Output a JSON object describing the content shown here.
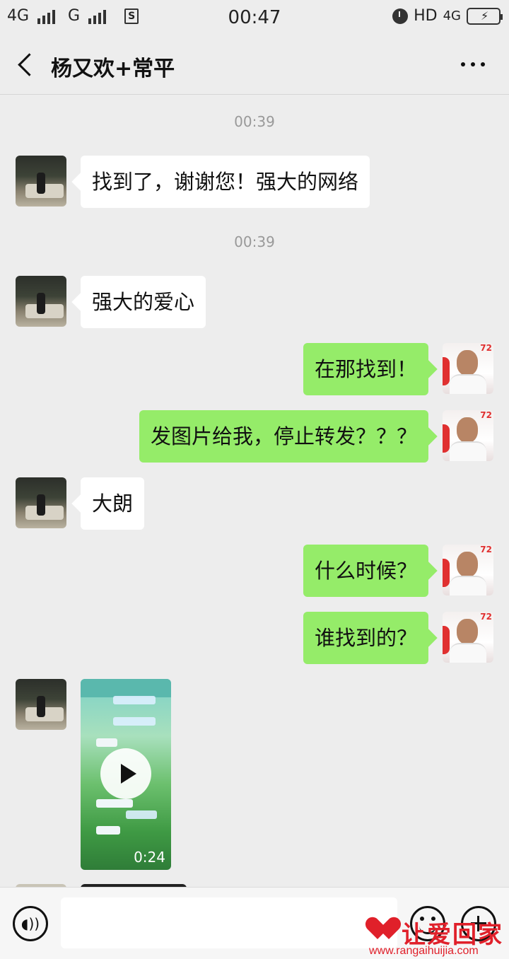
{
  "status_bar": {
    "left_network_1": "4G",
    "left_network_2": "G",
    "sim_icon": "S",
    "time": "00:47",
    "hd_label": "HD",
    "right_network": "4G"
  },
  "header": {
    "title": "杨又欢+常平",
    "back_icon": "chevron-left-icon",
    "more_icon": "more-dots-icon"
  },
  "messages": [
    {
      "type": "timestamp",
      "text": "00:39"
    },
    {
      "type": "text",
      "from": "them",
      "text": "找到了，谢谢您！强大的网络"
    },
    {
      "type": "timestamp",
      "text": "00:39"
    },
    {
      "type": "text",
      "from": "them",
      "text": "强大的爱心"
    },
    {
      "type": "text",
      "from": "me",
      "text": "在那找到！"
    },
    {
      "type": "text",
      "from": "me",
      "text": "发图片给我，停止转发？？？"
    },
    {
      "type": "text",
      "from": "them",
      "text": "大朗"
    },
    {
      "type": "text",
      "from": "me",
      "text": "什么时候？"
    },
    {
      "type": "text",
      "from": "me",
      "text": "谁找到的？"
    },
    {
      "type": "video",
      "from": "them",
      "duration": "0:24"
    }
  ],
  "input_bar": {
    "voice_icon": "voice-icon",
    "emoji_icon": "emoji-icon",
    "plus_icon": "plus-icon",
    "placeholder": ""
  },
  "watermark": {
    "text": "让爱回家",
    "url": "www.rangaihuijia.com"
  },
  "colors": {
    "background": "#ededed",
    "my_bubble": "#95ec69",
    "their_bubble": "#ffffff",
    "watermark": "#e0202a"
  }
}
